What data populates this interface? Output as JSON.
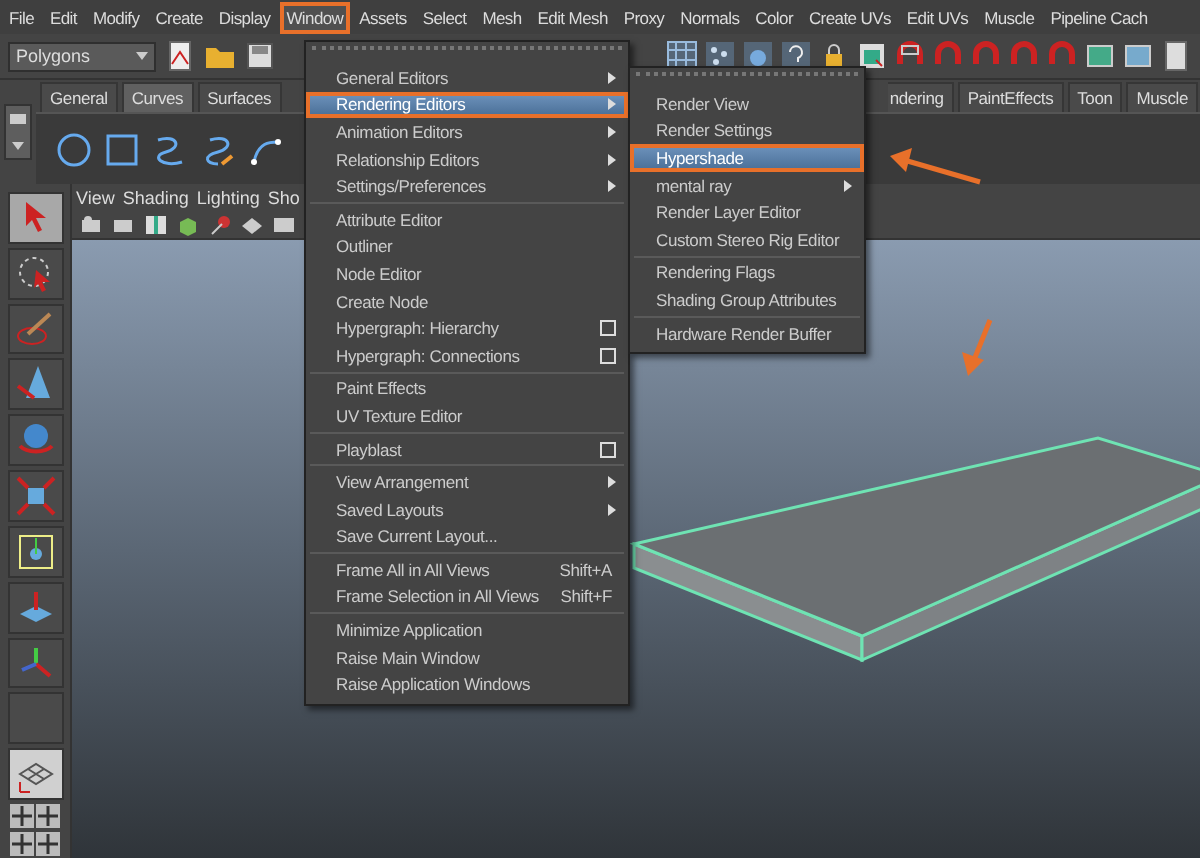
{
  "menu_bar": [
    {
      "label": "File",
      "selected": false
    },
    {
      "label": "Edit",
      "selected": false
    },
    {
      "label": "Modify",
      "selected": false
    },
    {
      "label": "Create",
      "selected": false
    },
    {
      "label": "Display",
      "selected": false
    },
    {
      "label": "Window",
      "selected": true
    },
    {
      "label": "Assets",
      "selected": false
    },
    {
      "label": "Select",
      "selected": false
    },
    {
      "label": "Mesh",
      "selected": false
    },
    {
      "label": "Edit Mesh",
      "selected": false
    },
    {
      "label": "Proxy",
      "selected": false
    },
    {
      "label": "Normals",
      "selected": false
    },
    {
      "label": "Color",
      "selected": false
    },
    {
      "label": "Create UVs",
      "selected": false
    },
    {
      "label": "Edit UVs",
      "selected": false
    },
    {
      "label": "Muscle",
      "selected": false
    },
    {
      "label": "Pipeline Cach",
      "selected": false
    }
  ],
  "toolbar": {
    "mode_dropdown": "Polygons"
  },
  "shelf_tabs": [
    {
      "label": "General",
      "selected": false
    },
    {
      "label": "Curves",
      "selected": true
    },
    {
      "label": "Surfaces",
      "selected": false
    },
    {
      "label": "ndering",
      "selected": false
    },
    {
      "label": "PaintEffects",
      "selected": false
    },
    {
      "label": "Toon",
      "selected": false
    },
    {
      "label": "Muscle",
      "selected": false
    }
  ],
  "viewport": {
    "panel_menu": [
      "View",
      "Shading",
      "Lighting",
      "Sho"
    ]
  },
  "window_menu": [
    {
      "kind": "item",
      "label": "General Editors",
      "submenu": true,
      "option_box": false,
      "selected": false
    },
    {
      "kind": "item",
      "label": "Rendering Editors",
      "submenu": true,
      "option_box": false,
      "selected": true
    },
    {
      "kind": "item",
      "label": "Animation Editors",
      "submenu": true,
      "option_box": false,
      "selected": false
    },
    {
      "kind": "item",
      "label": "Relationship Editors",
      "submenu": true,
      "option_box": false,
      "selected": false
    },
    {
      "kind": "item",
      "label": "Settings/Preferences",
      "submenu": true,
      "option_box": false,
      "selected": false
    },
    {
      "kind": "separator"
    },
    {
      "kind": "item",
      "label": "Attribute Editor",
      "submenu": false,
      "option_box": false,
      "selected": false
    },
    {
      "kind": "item",
      "label": "Outliner",
      "submenu": false,
      "option_box": false,
      "selected": false
    },
    {
      "kind": "item",
      "label": "Node Editor",
      "submenu": false,
      "option_box": false,
      "selected": false
    },
    {
      "kind": "item",
      "label": "Create Node",
      "submenu": false,
      "option_box": false,
      "selected": false
    },
    {
      "kind": "item",
      "label": "Hypergraph: Hierarchy",
      "submenu": false,
      "option_box": true,
      "selected": false
    },
    {
      "kind": "item",
      "label": "Hypergraph: Connections",
      "submenu": false,
      "option_box": true,
      "selected": false
    },
    {
      "kind": "separator"
    },
    {
      "kind": "item",
      "label": "Paint Effects",
      "submenu": false,
      "option_box": false,
      "selected": false
    },
    {
      "kind": "item",
      "label": "UV Texture Editor",
      "submenu": false,
      "option_box": false,
      "selected": false
    },
    {
      "kind": "separator"
    },
    {
      "kind": "item",
      "label": "Playblast",
      "submenu": false,
      "option_box": true,
      "selected": false
    },
    {
      "kind": "separator"
    },
    {
      "kind": "item",
      "label": "View Arrangement",
      "submenu": true,
      "option_box": false,
      "selected": false
    },
    {
      "kind": "item",
      "label": "Saved Layouts",
      "submenu": true,
      "option_box": false,
      "selected": false
    },
    {
      "kind": "item",
      "label": "Save Current Layout...",
      "submenu": false,
      "option_box": false,
      "selected": false
    },
    {
      "kind": "separator"
    },
    {
      "kind": "item",
      "label": "Frame All in All Views",
      "shortcut": "Shift+A",
      "submenu": false,
      "option_box": false,
      "selected": false
    },
    {
      "kind": "item",
      "label": "Frame Selection in All Views",
      "shortcut": "Shift+F",
      "submenu": false,
      "option_box": false,
      "selected": false
    },
    {
      "kind": "separator"
    },
    {
      "kind": "item",
      "label": "Minimize Application",
      "submenu": false,
      "option_box": false,
      "selected": false
    },
    {
      "kind": "item",
      "label": "Raise Main Window",
      "submenu": false,
      "option_box": false,
      "selected": false
    },
    {
      "kind": "item",
      "label": "Raise Application Windows",
      "submenu": false,
      "option_box": false,
      "selected": false
    }
  ],
  "rendering_submenu": [
    {
      "kind": "item",
      "label": "Render View",
      "submenu": false,
      "option_box": false,
      "selected": false
    },
    {
      "kind": "item",
      "label": "Render Settings",
      "submenu": false,
      "option_box": false,
      "selected": false
    },
    {
      "kind": "item",
      "label": "Hypershade",
      "submenu": false,
      "option_box": false,
      "selected": true
    },
    {
      "kind": "item",
      "label": "mental ray",
      "submenu": true,
      "option_box": false,
      "selected": false
    },
    {
      "kind": "item",
      "label": "Render Layer Editor",
      "submenu": false,
      "option_box": false,
      "selected": false
    },
    {
      "kind": "item",
      "label": "Custom Stereo Rig Editor",
      "submenu": false,
      "option_box": false,
      "selected": false
    },
    {
      "kind": "separator"
    },
    {
      "kind": "item",
      "label": "Rendering Flags",
      "submenu": false,
      "option_box": false,
      "selected": false
    },
    {
      "kind": "item",
      "label": "Shading Group Attributes",
      "submenu": false,
      "option_box": false,
      "selected": false
    },
    {
      "kind": "separator"
    },
    {
      "kind": "item",
      "label": "Hardware Render Buffer",
      "submenu": false,
      "option_box": false,
      "selected": false
    }
  ]
}
